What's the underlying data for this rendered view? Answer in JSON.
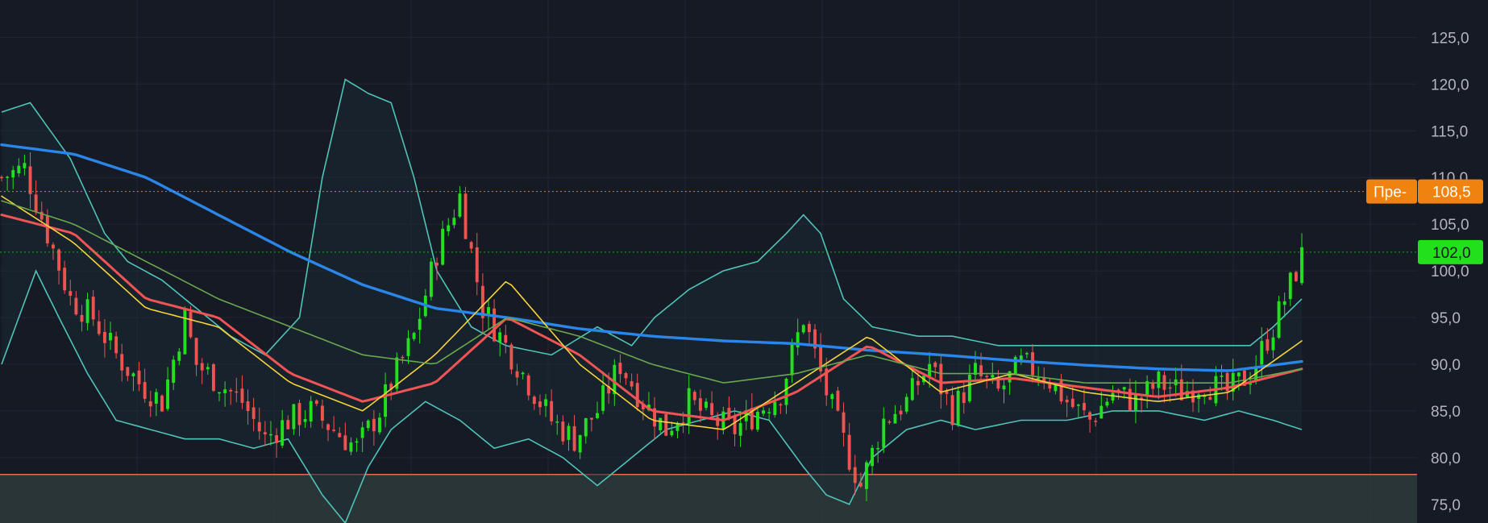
{
  "colors": {
    "background": "#161a25",
    "grid": "#232734",
    "candle_up": "#22e01c",
    "candle_down": "#ef5350",
    "ma_blue": "#2a86e8",
    "ma_red": "#f05454",
    "ma_yellow": "#f5d33a",
    "ma_green": "#6aa84f",
    "bollinger": "#4fc3b8",
    "bollinger_fill": "#1c2a35",
    "zone_fill": "#2d3b3b",
    "zone_line": "#e56b57",
    "prev_close_line": "#e07b1a",
    "prev_tag": "#f0820f",
    "last_price_tag": "#22e01c"
  },
  "price_axis": {
    "ticks": [
      "125,0",
      "120,0",
      "115,0",
      "110,0",
      "105,0",
      "100,0",
      "95,0",
      "90,0",
      "85,0",
      "80,0",
      "75,0"
    ]
  },
  "tags": {
    "prev_label": "Пре-",
    "prev_value": "108,5",
    "last_value": "102,0"
  },
  "chart_data": {
    "type": "candlestick",
    "ylim": [
      73,
      129
    ],
    "grid": true,
    "prev_close": 108.5,
    "last_price": 102.0,
    "zone_top": 78.2,
    "candle_count": 228,
    "close_path": [
      [
        0,
        110
      ],
      [
        4,
        111
      ],
      [
        8,
        104
      ],
      [
        12,
        97
      ],
      [
        16,
        95
      ],
      [
        20,
        91
      ],
      [
        24,
        88
      ],
      [
        28,
        86
      ],
      [
        32,
        95
      ],
      [
        34,
        90
      ],
      [
        38,
        88
      ],
      [
        42,
        86
      ],
      [
        46,
        82
      ],
      [
        50,
        84
      ],
      [
        54,
        85
      ],
      [
        58,
        83
      ],
      [
        62,
        81
      ],
      [
        66,
        85
      ],
      [
        68,
        88
      ],
      [
        72,
        93
      ],
      [
        76,
        102
      ],
      [
        80,
        108
      ],
      [
        84,
        96
      ],
      [
        88,
        92
      ],
      [
        92,
        88
      ],
      [
        96,
        84
      ],
      [
        100,
        82
      ],
      [
        104,
        85
      ],
      [
        108,
        90
      ],
      [
        112,
        86
      ],
      [
        116,
        83
      ],
      [
        120,
        86
      ],
      [
        124,
        84
      ],
      [
        128,
        83
      ],
      [
        132,
        85
      ],
      [
        136,
        87
      ],
      [
        140,
        95
      ],
      [
        144,
        87
      ],
      [
        148,
        80
      ],
      [
        150,
        77
      ],
      [
        154,
        84
      ],
      [
        158,
        86
      ],
      [
        162,
        90
      ],
      [
        166,
        85
      ],
      [
        170,
        89
      ],
      [
        174,
        87
      ],
      [
        178,
        90
      ],
      [
        182,
        89
      ],
      [
        186,
        86
      ],
      [
        190,
        84
      ],
      [
        194,
        87
      ],
      [
        198,
        86
      ],
      [
        202,
        88
      ],
      [
        206,
        87
      ],
      [
        210,
        88
      ],
      [
        214,
        87
      ],
      [
        218,
        89
      ],
      [
        222,
        94
      ],
      [
        227,
        101.5
      ]
    ],
    "series": [
      {
        "values": [
          113.5,
          112.5,
          110,
          106,
          102,
          98.5,
          96,
          95,
          93.8,
          93,
          92.5,
          92.2,
          91.5,
          91,
          90.4,
          89.9,
          89.5,
          89.3,
          90.3
        ]
      },
      {
        "values": [
          106,
          104,
          97,
          95,
          89,
          86,
          88,
          95,
          91,
          85,
          84,
          87,
          92,
          88,
          88.5,
          87.5,
          86.5,
          87.5,
          89.5
        ]
      },
      {
        "values": [
          108,
          103,
          96,
          94,
          88,
          85,
          91,
          99,
          90,
          84,
          83,
          88,
          93,
          87,
          89,
          87,
          86,
          87,
          92.5
        ]
      },
      {
        "values": [
          107.5,
          105,
          101,
          97,
          94,
          91,
          90,
          95,
          93,
          90,
          88,
          89,
          91,
          89,
          89,
          88,
          88,
          88,
          89.5
        ]
      }
    ],
    "bollinger_upper": [
      [
        0,
        117
      ],
      [
        5,
        118
      ],
      [
        12,
        112
      ],
      [
        18,
        104
      ],
      [
        22,
        101
      ],
      [
        28,
        99
      ],
      [
        34,
        96
      ],
      [
        40,
        93
      ],
      [
        46,
        91
      ],
      [
        52,
        95
      ],
      [
        56,
        110
      ],
      [
        60,
        120.5
      ],
      [
        64,
        119
      ],
      [
        68,
        118
      ],
      [
        72,
        110
      ],
      [
        76,
        100
      ],
      [
        82,
        94
      ],
      [
        88,
        92
      ],
      [
        96,
        91
      ],
      [
        104,
        94
      ],
      [
        110,
        92
      ],
      [
        114,
        95
      ],
      [
        120,
        98
      ],
      [
        126,
        100
      ],
      [
        132,
        101
      ],
      [
        137,
        104
      ],
      [
        140,
        106
      ],
      [
        143,
        104
      ],
      [
        147,
        97
      ],
      [
        152,
        94
      ],
      [
        160,
        93
      ],
      [
        166,
        93
      ],
      [
        174,
        92
      ],
      [
        182,
        92
      ],
      [
        190,
        92
      ],
      [
        198,
        92
      ],
      [
        206,
        92
      ],
      [
        212,
        92
      ],
      [
        218,
        92
      ],
      [
        222,
        94
      ],
      [
        227,
        97
      ]
    ],
    "bollinger_lower": [
      [
        0,
        90
      ],
      [
        6,
        100
      ],
      [
        10,
        95
      ],
      [
        15,
        89
      ],
      [
        20,
        84
      ],
      [
        26,
        83
      ],
      [
        32,
        82
      ],
      [
        38,
        82
      ],
      [
        44,
        81
      ],
      [
        50,
        82
      ],
      [
        56,
        76
      ],
      [
        60,
        73
      ],
      [
        64,
        79
      ],
      [
        68,
        83
      ],
      [
        74,
        86
      ],
      [
        80,
        84
      ],
      [
        86,
        81
      ],
      [
        92,
        82
      ],
      [
        98,
        80
      ],
      [
        104,
        77
      ],
      [
        110,
        80
      ],
      [
        116,
        83
      ],
      [
        122,
        84
      ],
      [
        128,
        85
      ],
      [
        134,
        84
      ],
      [
        140,
        79
      ],
      [
        144,
        76
      ],
      [
        148,
        75
      ],
      [
        152,
        80
      ],
      [
        158,
        83
      ],
      [
        164,
        84
      ],
      [
        170,
        83
      ],
      [
        178,
        84
      ],
      [
        186,
        84
      ],
      [
        194,
        85
      ],
      [
        202,
        85
      ],
      [
        210,
        84
      ],
      [
        216,
        85
      ],
      [
        222,
        84
      ],
      [
        227,
        83
      ]
    ]
  }
}
